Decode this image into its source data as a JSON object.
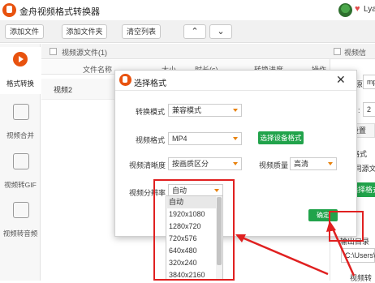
{
  "app": {
    "title": "金舟视频格式转换器",
    "user_name": "Lya"
  },
  "toolbar": {
    "add_file": "添加文件",
    "add_folder": "添加文件夹",
    "clear_list": "清空列表",
    "up": "⌃",
    "down": "⌄"
  },
  "sidebar": {
    "items": [
      {
        "label": "格式转换",
        "icon": "convert-icon"
      },
      {
        "label": "视频合并",
        "icon": "merge-icon"
      },
      {
        "label": "视频转GIF",
        "icon": "gif-icon"
      },
      {
        "label": "视频转音频",
        "icon": "audio-icon"
      }
    ]
  },
  "list": {
    "section_title": "视频源文件(1)",
    "columns": [
      "文件名称",
      "大小",
      "时长(s)",
      "转换进度",
      "操作"
    ],
    "rows": [
      {
        "name": "视频2"
      }
    ]
  },
  "right_panel": {
    "header": "视频信",
    "row1_label": "原:",
    "row1_value": "mp",
    "row2_label": ":",
    "row2_value": "2",
    "settings_tab": "设置",
    "format_label": "格式",
    "format_value": "4 同源文",
    "green_button": "选择格式",
    "output_dir_label": "输出目录",
    "output_path": "C:\\Users\\ad",
    "bottom_text": "视频转"
  },
  "dialog": {
    "title": "选择格式",
    "close": "✕",
    "mode_label": "转换模式",
    "mode_value": "兼容模式",
    "format_label": "视频格式",
    "format_value": "MP4",
    "device_format_button": "选择设备格式",
    "clarity_label": "视频清晰度",
    "clarity_value": "按画质区分",
    "quality_label": "视频质量",
    "quality_value": "高清",
    "resolution_label": "视频分辨率",
    "resolution_value": "自动",
    "confirm": "确定",
    "resolution_options": [
      "自动",
      "1920x1080",
      "1280x720",
      "720x576",
      "640x480",
      "320x240",
      "3840x2160"
    ]
  },
  "annotations": {
    "highlight_color": "#e02020"
  }
}
